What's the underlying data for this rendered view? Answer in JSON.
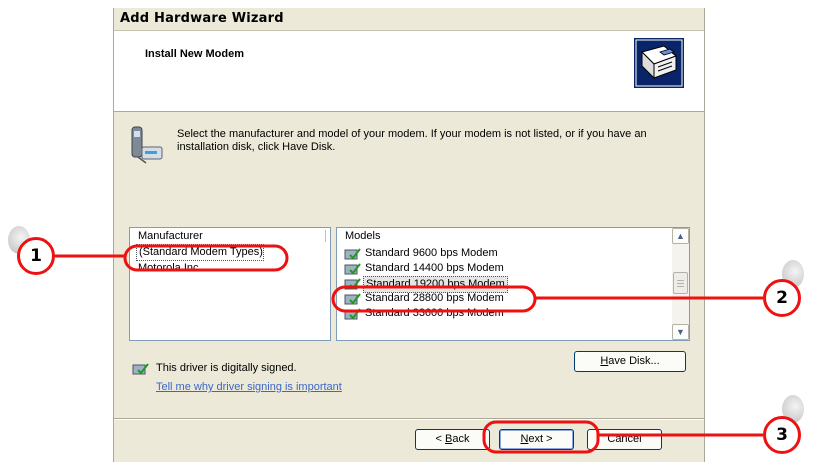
{
  "window": {
    "title": "Add Hardware Wizard",
    "header_title": "Install New Modem",
    "intro_text": "Select the manufacturer and model of your modem. If your modem is not listed, or if you have an installation disk, click Have Disk."
  },
  "manufacturer_list": {
    "header": "Manufacturer",
    "items": [
      "(Standard Modem Types)",
      "Motorola Inc"
    ],
    "selected_index": 0
  },
  "models_list": {
    "header": "Models",
    "items": [
      "Standard  9600 bps Modem",
      "Standard 14400 bps Modem",
      "Standard 19200 bps Modem",
      "Standard 28800 bps Modem",
      "Standard 33600 bps Modem"
    ],
    "selected_index": 2
  },
  "signing": {
    "text": "This driver is digitally signed.",
    "link": "Tell me why driver signing is important"
  },
  "buttons": {
    "have_disk": {
      "mnemonic": "H",
      "rest": "ave Disk..."
    },
    "back": {
      "prefix": "< ",
      "mnemonic": "B",
      "rest": "ack"
    },
    "next": {
      "mnemonic": "N",
      "rest": "ext >"
    },
    "cancel": "Cancel"
  },
  "callouts": [
    "1",
    "2",
    "3"
  ],
  "colors": {
    "callout": "#ee1111",
    "link": "#3c67c7",
    "window_bg": "#ece9d8",
    "selection_border": "#555555"
  },
  "icons": {
    "header": "hardware-card-icon",
    "intro": "modem-phone-icon",
    "model": "signed-driver-icon",
    "signed": "signed-driver-icon"
  }
}
